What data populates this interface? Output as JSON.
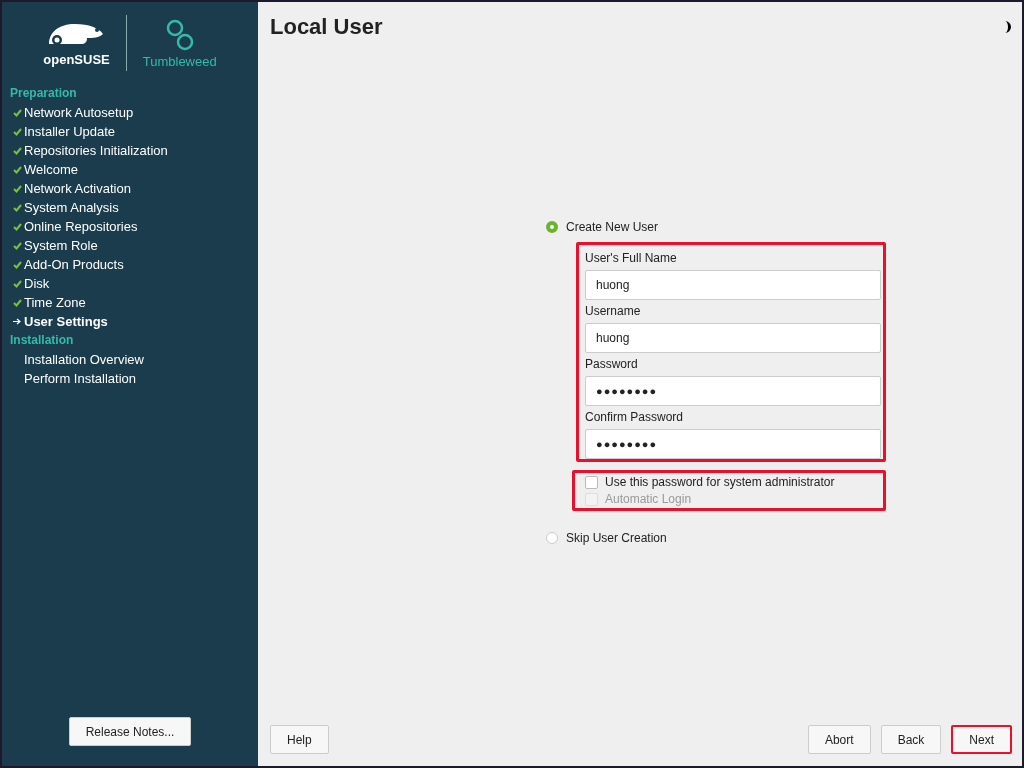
{
  "sidebar": {
    "brand": "openSUSE",
    "product": "Tumbleweed",
    "sections": [
      {
        "title": "Preparation",
        "steps": [
          {
            "label": "Network Autosetup",
            "done": true,
            "current": false
          },
          {
            "label": "Installer Update",
            "done": true,
            "current": false
          },
          {
            "label": "Repositories Initialization",
            "done": true,
            "current": false
          },
          {
            "label": "Welcome",
            "done": true,
            "current": false
          },
          {
            "label": "Network Activation",
            "done": true,
            "current": false
          },
          {
            "label": "System Analysis",
            "done": true,
            "current": false
          },
          {
            "label": "Online Repositories",
            "done": true,
            "current": false
          },
          {
            "label": "System Role",
            "done": true,
            "current": false
          },
          {
            "label": "Add-On Products",
            "done": true,
            "current": false
          },
          {
            "label": "Disk",
            "done": true,
            "current": false
          },
          {
            "label": "Time Zone",
            "done": true,
            "current": false
          },
          {
            "label": "User Settings",
            "done": false,
            "current": true
          }
        ]
      },
      {
        "title": "Installation",
        "steps": [
          {
            "label": "Installation Overview",
            "done": false,
            "current": false
          },
          {
            "label": "Perform Installation",
            "done": false,
            "current": false
          }
        ]
      }
    ],
    "release_notes": "Release Notes..."
  },
  "title": "Local User",
  "options": [
    {
      "label": "Create New User",
      "selected": true
    },
    {
      "label": "Skip User Creation",
      "selected": false
    }
  ],
  "user_form": {
    "highlighted": true,
    "fields": [
      {
        "label": "User's Full Name",
        "value": "huong",
        "kind": "text"
      },
      {
        "label": "Username",
        "value": "huong",
        "kind": "text"
      },
      {
        "label": "Password",
        "value": "●●●●●●●●",
        "kind": "password"
      },
      {
        "label": "Confirm Password",
        "value": "●●●●●●●●",
        "kind": "password"
      }
    ]
  },
  "checkboxes": {
    "highlighted": true,
    "items": [
      {
        "label": "Use this password for system administrator",
        "checked": false,
        "disabled": false
      },
      {
        "label": "Automatic Login",
        "checked": false,
        "disabled": true
      }
    ]
  },
  "buttons_left": [
    {
      "label": "Help",
      "highlighted": false
    }
  ],
  "buttons_right": [
    {
      "label": "Abort",
      "highlighted": false
    },
    {
      "label": "Back",
      "highlighted": false
    },
    {
      "label": "Next",
      "highlighted": true
    }
  ]
}
